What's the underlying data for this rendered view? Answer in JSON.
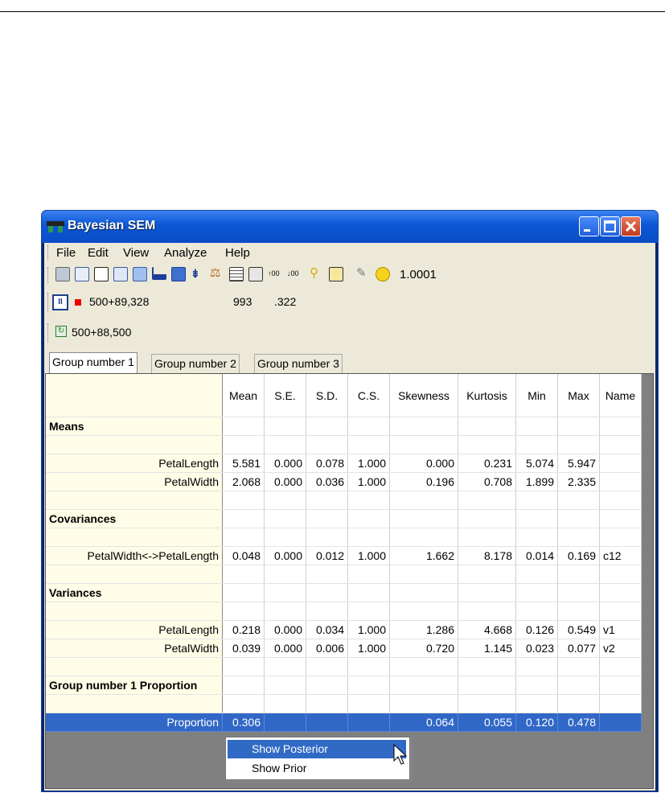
{
  "window": {
    "title": "Bayesian SEM"
  },
  "menu": [
    "File",
    "Edit",
    "View",
    "Analyze",
    "Help"
  ],
  "toolbar": {
    "value": "1.0001"
  },
  "status": {
    "samples": "500+89,328",
    "accepted": "993",
    "rate": ".322",
    "burn": "500+88,500"
  },
  "tabs": [
    "Group number 1",
    "Group number 2",
    "Group number 3"
  ],
  "table": {
    "columns": [
      "Mean",
      "S.E.",
      "S.D.",
      "C.S.",
      "Skewness",
      "Kurtosis",
      "Min",
      "Max",
      "Name"
    ],
    "sections": {
      "means": "Means",
      "covariances": "Covariances",
      "variances": "Variances",
      "proportion": "Group number 1 Proportion"
    },
    "rows": {
      "petal_length_mean": [
        "PetalLength",
        "5.581",
        "0.000",
        "0.078",
        "1.000",
        "0.000",
        "0.231",
        "5.074",
        "5.947",
        ""
      ],
      "petal_width_mean": [
        "PetalWidth",
        "2.068",
        "0.000",
        "0.036",
        "1.000",
        "0.196",
        "0.708",
        "1.899",
        "2.335",
        ""
      ],
      "cov": [
        "PetalWidth<->PetalLength",
        "0.048",
        "0.000",
        "0.012",
        "1.000",
        "1.662",
        "8.178",
        "0.014",
        "0.169",
        "c12"
      ],
      "petal_length_var": [
        "PetalLength",
        "0.218",
        "0.000",
        "0.034",
        "1.000",
        "1.286",
        "4.668",
        "0.126",
        "0.549",
        "v1"
      ],
      "petal_width_var": [
        "PetalWidth",
        "0.039",
        "0.000",
        "0.006",
        "1.000",
        "0.720",
        "1.145",
        "0.023",
        "0.077",
        "v2"
      ],
      "proportion": [
        "Proportion",
        "0.306",
        "",
        "",
        "",
        "0.064",
        "0.055",
        "0.120",
        "0.478",
        ""
      ]
    }
  },
  "context_menu": [
    "Show Posterior",
    "Show Prior"
  ],
  "icons": [
    "print-icon",
    "preview-icon",
    "copy-icon",
    "save-icon",
    "clipboard-icon",
    "histogram-icon",
    "plot-icon",
    "trace-icon",
    "balance-icon",
    "table-icon",
    "window-icon",
    "decimal-increase-icon",
    "decimal-decrease-icon",
    "thumbtack-icon",
    "book-icon",
    "wrench-icon",
    "smiley-icon"
  ]
}
